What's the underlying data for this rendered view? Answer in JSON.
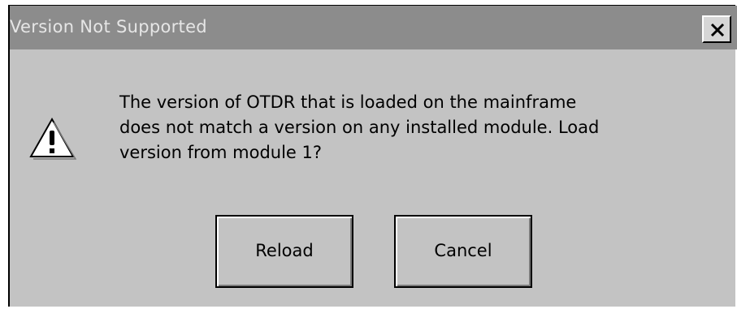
{
  "window": {
    "title": "Version Not Supported",
    "close_icon": "close-icon"
  },
  "dialog": {
    "icon": "warning-icon",
    "message_lines": [
      "The version of OTDR that is loaded on the mainframe",
      "does not match a version on any installed module. Load",
      "version from module 1?"
    ]
  },
  "buttons": {
    "reload_label": "Reload",
    "cancel_label": "Cancel"
  },
  "colors": {
    "titlebar": "#8c8c8c",
    "dialog_bg": "#c3c3c3",
    "title_text": "#e6e6e6"
  }
}
